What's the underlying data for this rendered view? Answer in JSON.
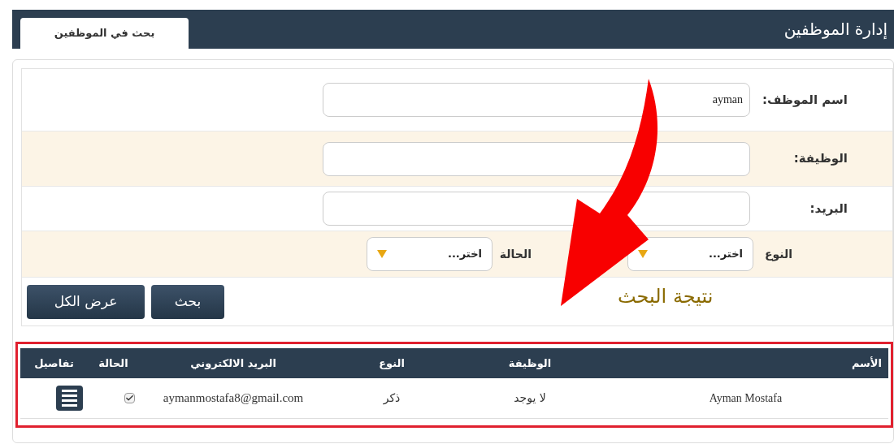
{
  "header": {
    "title": "إدارة الموظفين",
    "tabs": [
      {
        "label": "بحث في الموظفين",
        "selected": true
      }
    ]
  },
  "form": {
    "fields": [
      {
        "label": "اسم الموظف:",
        "value": "ayman"
      },
      {
        "label": "الوظيفة:"
      },
      {
        "label": "البريد:"
      }
    ],
    "selects": [
      {
        "label": "النوع",
        "value": "اختر..."
      },
      {
        "label": "الحالة",
        "value": "اختر..."
      }
    ],
    "buttons": [
      "بحث",
      "عرض الكل"
    ]
  },
  "annotation": "نتيجة البحث",
  "results": {
    "columns": [
      "الأسم",
      "الوظيفة",
      "النوع",
      "البريد الالكتروني",
      "الحالة",
      "تفاصيل"
    ],
    "rows": [
      {
        "name": "Ayman Mostafa",
        "job": "لا يوجد",
        "gender": "ذكر",
        "email": "aymanmostafa8@gmail.com",
        "checked": true
      }
    ]
  }
}
